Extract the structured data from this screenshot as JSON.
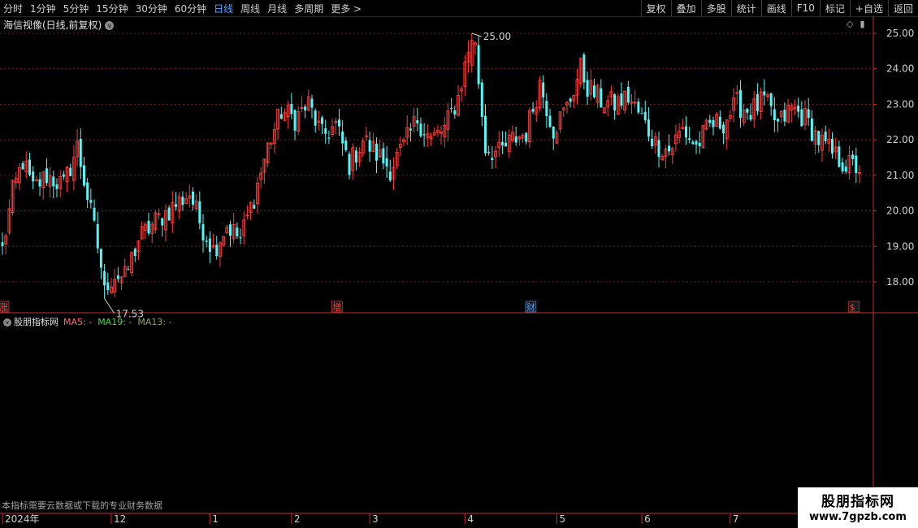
{
  "toolbar": {
    "periods": [
      "分时",
      "1分钟",
      "5分钟",
      "15分钟",
      "30分钟",
      "60分钟",
      "日线",
      "周线",
      "月线",
      "多周期",
      "更多 >"
    ],
    "active_period": "日线",
    "right_buttons": [
      "复权",
      "叠加",
      "多股",
      "统计",
      "画线",
      "F10",
      "标记",
      "+自选",
      "返回"
    ]
  },
  "main_panel": {
    "title": "海信视像(日线,前复权)",
    "circle_glyph": "v",
    "diamond_glyph": "◇",
    "square_glyph": "▮",
    "high_label": "25.00",
    "low_label": "17.53",
    "event_markers": [
      {
        "text": "涨",
        "date_index": 0,
        "color": "#ff3b3b"
      },
      {
        "text": "增",
        "date_index": 98,
        "color": "#ff3b3b"
      },
      {
        "text": "财",
        "date_index": 155,
        "color": "#4fa6ff"
      },
      {
        "text": "$",
        "date_index": 250,
        "color": "#ff3b3b"
      }
    ]
  },
  "sub_panel": {
    "title": "股朋指标网",
    "ma_labels": [
      {
        "text": "MA5: -",
        "color": "#ff6b6b"
      },
      {
        "text": "MA19: -",
        "color": "#4cd24c"
      },
      {
        "text": "MA13: -",
        "color": "#8fa86a"
      }
    ]
  },
  "footer_note": "本指标需要云数据或下载的专业财务数据",
  "time_axis": [
    {
      "label": "2024年",
      "date_index": 0
    },
    {
      "label": "12",
      "date_index": 32
    },
    {
      "label": "1",
      "date_index": 61
    },
    {
      "label": "2",
      "date_index": 85
    },
    {
      "label": "3",
      "date_index": 108
    },
    {
      "label": "4",
      "date_index": 136
    },
    {
      "label": "5",
      "date_index": 163
    },
    {
      "label": "6",
      "date_index": 188
    },
    {
      "label": "7",
      "date_index": 214
    }
  ],
  "watermark": {
    "line1": "股朋指标网",
    "line2": "www.7gpzb.com"
  },
  "chart_data": {
    "type": "candlestick",
    "y_ticks": [
      "25.00",
      "24.00",
      "23.00",
      "22.00",
      "21.00",
      "20.00",
      "19.00",
      "18.00"
    ],
    "ylim": [
      17.2,
      25.4
    ],
    "anchors": [
      [
        0,
        18.9
      ],
      [
        3,
        20.5
      ],
      [
        6,
        21.4
      ],
      [
        9,
        20.6
      ],
      [
        13,
        21.0
      ],
      [
        18,
        20.7
      ],
      [
        22,
        21.8
      ],
      [
        25,
        20.4
      ],
      [
        28,
        19.0
      ],
      [
        30,
        17.9
      ],
      [
        33,
        18.2
      ],
      [
        36,
        18.1
      ],
      [
        40,
        19.2
      ],
      [
        45,
        19.7
      ],
      [
        50,
        20.1
      ],
      [
        55,
        20.5
      ],
      [
        58,
        19.7
      ],
      [
        62,
        18.9
      ],
      [
        66,
        19.6
      ],
      [
        70,
        19.2
      ],
      [
        74,
        20.4
      ],
      [
        78,
        21.8
      ],
      [
        82,
        22.8
      ],
      [
        86,
        22.6
      ],
      [
        90,
        23.0
      ],
      [
        94,
        22.1
      ],
      [
        98,
        22.4
      ],
      [
        102,
        21.3
      ],
      [
        106,
        22.0
      ],
      [
        110,
        21.6
      ],
      [
        114,
        21.2
      ],
      [
        118,
        21.8
      ],
      [
        122,
        22.6
      ],
      [
        126,
        22.0
      ],
      [
        130,
        22.3
      ],
      [
        134,
        23.2
      ],
      [
        137,
        24.5
      ],
      [
        139,
        24.6
      ],
      [
        142,
        21.8
      ],
      [
        146,
        21.6
      ],
      [
        150,
        22.0
      ],
      [
        154,
        22.2
      ],
      [
        158,
        23.6
      ],
      [
        162,
        22.3
      ],
      [
        166,
        22.9
      ],
      [
        170,
        24.0
      ],
      [
        172,
        23.5
      ],
      [
        176,
        23.1
      ],
      [
        180,
        23.0
      ],
      [
        184,
        23.2
      ],
      [
        188,
        22.6
      ],
      [
        192,
        21.9
      ],
      [
        196,
        21.7
      ],
      [
        200,
        22.3
      ],
      [
        204,
        21.8
      ],
      [
        208,
        22.4
      ],
      [
        212,
        22.5
      ],
      [
        216,
        23.0
      ],
      [
        220,
        22.8
      ],
      [
        224,
        23.1
      ],
      [
        228,
        22.4
      ],
      [
        232,
        22.9
      ],
      [
        236,
        22.6
      ],
      [
        240,
        22.0
      ],
      [
        244,
        21.6
      ],
      [
        248,
        21.3
      ],
      [
        252,
        21.2
      ]
    ],
    "count": 253,
    "high_index": 138,
    "low_index": 30,
    "seed": 12345,
    "up_color": "#ff3b3b",
    "down_color": "#54f6f6"
  }
}
